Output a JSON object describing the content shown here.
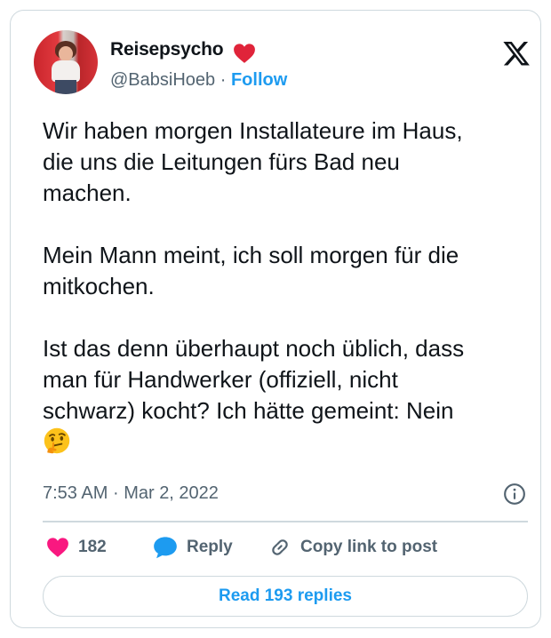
{
  "author": {
    "name": "Reisepsycho",
    "handle": "@BabsiHoeb",
    "separator": "·",
    "follow_label": "Follow",
    "badge_icon": "red-heart-emoji"
  },
  "tweet": {
    "paragraphs": [
      "Wir haben morgen Installateure im Haus,\ndie uns die Leitungen fürs Bad neu\nmachen.",
      "Mein Mann meint, ich soll morgen für die\nmitkochen.",
      "Ist das denn überhaupt noch üblich, dass\nman für Handwerker (offiziell, nicht\nschwarz) kocht? Ich hätte gemeint: Nein"
    ],
    "trailing_emoji": "thinking-face-emoji",
    "time": "7:53 AM",
    "date_separator": "·",
    "date": "Mar 2, 2022"
  },
  "actions": {
    "like_count": "182",
    "reply_label": "Reply",
    "copy_link_label": "Copy link to post",
    "read_replies_label": "Read 193 replies"
  },
  "icons": {
    "brand": "x-logo",
    "info": "info-icon",
    "like": "heart-icon",
    "reply": "speech-bubble-icon",
    "copy": "link-icon"
  },
  "colors": {
    "accent": "#1d9bf0",
    "like": "#f91880",
    "text": "#0f1419",
    "muted": "#536471",
    "border": "#cfd9de"
  }
}
